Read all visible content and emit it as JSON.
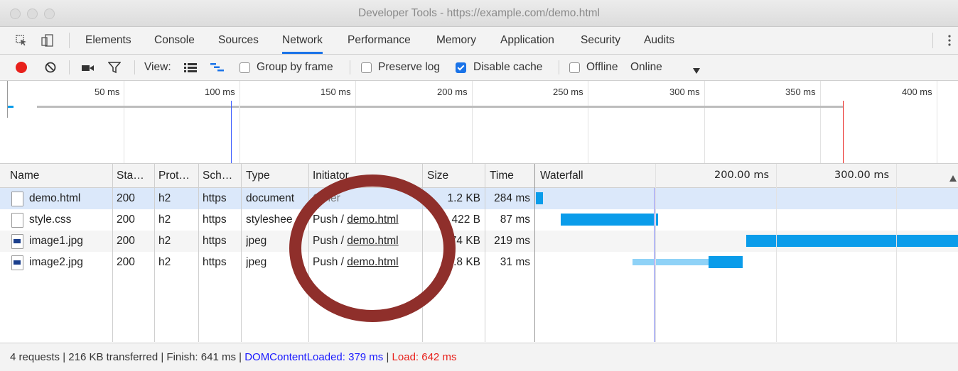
{
  "window": {
    "title": "Developer Tools - https://example.com/demo.html"
  },
  "tabs": [
    "Elements",
    "Console",
    "Sources",
    "Network",
    "Performance",
    "Memory",
    "Application",
    "Security",
    "Audits"
  ],
  "active_tab": "Network",
  "toolbar": {
    "view_label": "View:",
    "group_by_frame": "Group by frame",
    "preserve_log": "Preserve log",
    "disable_cache": "Disable cache",
    "offline": "Offline",
    "throttle": "Online",
    "disable_cache_checked": true
  },
  "overview": {
    "ticks": [
      "50 ms",
      "100 ms",
      "150 ms",
      "200 ms",
      "250 ms",
      "300 ms",
      "350 ms",
      "400 ms"
    ]
  },
  "table": {
    "headers": {
      "name": "Name",
      "status": "Sta…",
      "protocol": "Prot…",
      "scheme": "Sch…",
      "type": "Type",
      "initiator": "Initiator",
      "size": "Size",
      "time": "Time",
      "waterfall": "Waterfall"
    },
    "waterfall_ticks": [
      "200.00 ms",
      "300.00 ms"
    ],
    "rows": [
      {
        "name": "demo.html",
        "status": "200",
        "protocol": "h2",
        "scheme": "https",
        "type": "document",
        "initiator": "Other",
        "initiator_link": "",
        "size": "1.2 KB",
        "time": "284 ms"
      },
      {
        "name": "style.css",
        "status": "200",
        "protocol": "h2",
        "scheme": "https",
        "type": "styleshee",
        "initiator": "Push / ",
        "initiator_link": "demo.html",
        "size": "422 B",
        "time": "87 ms"
      },
      {
        "name": "image1.jpg",
        "status": "200",
        "protocol": "h2",
        "scheme": "https",
        "type": "jpeg",
        "initiator": "Push / ",
        "initiator_link": "demo.html",
        "size": "174 KB",
        "time": "219 ms"
      },
      {
        "name": "image2.jpg",
        "status": "200",
        "protocol": "h2",
        "scheme": "https",
        "type": "jpeg",
        "initiator": "Push / ",
        "initiator_link": "demo.html",
        "size": "40.8 KB",
        "time": "31 ms"
      }
    ]
  },
  "status": {
    "summary": "4 requests | 216 KB transferred | Finish: 641 ms | ",
    "dom_content_loaded": "DOMContentLoaded: 379 ms",
    "divider": " | ",
    "load": "Load: 642 ms"
  },
  "colors": {
    "accent": "#1a73e8",
    "record": "#e8201b",
    "dom_content_loaded": "#1a1aff",
    "load": "#e8201b",
    "waterfall_bar": "#0a9cea",
    "waterfall_wait": "#8fd2f7",
    "annotation_circle": "#8f2f2b"
  }
}
